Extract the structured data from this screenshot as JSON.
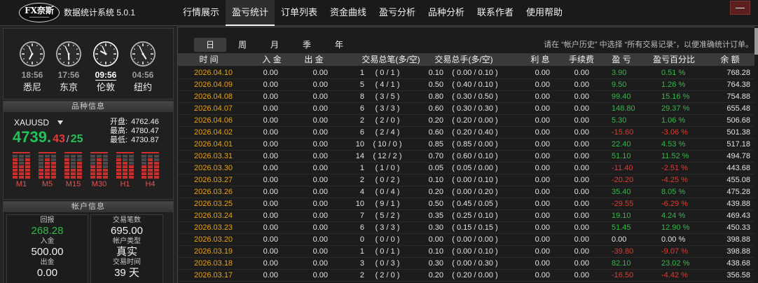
{
  "app": {
    "logo_text": "FX奈斯",
    "title": "数据统计系统 5.0.1",
    "minimize_label": "—"
  },
  "nav": {
    "active_index": 1,
    "tabs": [
      {
        "label": "行情展示"
      },
      {
        "label": "盈亏统计"
      },
      {
        "label": "订单列表"
      },
      {
        "label": "资金曲线"
      },
      {
        "label": "盈亏分析"
      },
      {
        "label": "品种分析"
      },
      {
        "label": "联系作者"
      },
      {
        "label": "使用帮助"
      }
    ]
  },
  "clocks": [
    {
      "time": "18:56",
      "city": "悉尼",
      "active": false
    },
    {
      "time": "17:56",
      "city": "东京",
      "active": false
    },
    {
      "time": "09:56",
      "city": "伦敦",
      "active": true
    },
    {
      "time": "04:56",
      "city": "纽约",
      "active": false
    }
  ],
  "symbol": {
    "section_title": "品种信息",
    "name": "XAUUSD",
    "dropdown_icon": "caret-down-icon",
    "price_main": "4739.",
    "price_pips": "43",
    "price_separator": "/",
    "price_pips_2": "25",
    "open_label": "开盘:",
    "open": "4762.46",
    "high_label": "最高:",
    "high": "4780.47",
    "low_label": "最低:",
    "low": "4730.87",
    "timeframes": [
      {
        "label": "M1",
        "levels": [
          0.86,
          0.57,
          0.86
        ]
      },
      {
        "label": "M5",
        "levels": [
          0.43,
          0.86,
          0.71
        ]
      },
      {
        "label": "M15",
        "levels": [
          0.86,
          0.43,
          0.71
        ]
      },
      {
        "label": "M30",
        "levels": [
          0.57,
          0.86,
          0.43
        ]
      },
      {
        "label": "H1",
        "levels": [
          0.86,
          0.71,
          0.57
        ]
      },
      {
        "label": "H4",
        "levels": [
          0.57,
          0.86,
          0.71
        ]
      }
    ]
  },
  "account": {
    "section_title": "帐户信息",
    "left": [
      {
        "label": "回报",
        "value": "268.28"
      },
      {
        "label": "入金",
        "value": "500.00"
      },
      {
        "label": "出金",
        "value": "0.00"
      }
    ],
    "right": [
      {
        "label": "交易笔数",
        "value": "695.00"
      },
      {
        "label": "帐户类型",
        "value": "真实"
      },
      {
        "label": "交易时间",
        "value": "39 天"
      }
    ]
  },
  "stats": {
    "active_period": 0,
    "periods": [
      "日",
      "周",
      "月",
      "季",
      "年"
    ],
    "hint": "请在 “帐户历史” 中选择 “所有交易记录”，以便准确统计订单。",
    "columns": [
      "时 间",
      "入 金",
      "出 金",
      "交易总笔(多/空)",
      "交易总手(多/空)",
      "利 息",
      "手续费",
      "盈 亏",
      "盈亏百分比",
      "余 额"
    ],
    "rows": [
      {
        "date": "2026.04.10",
        "deposit": "0.00",
        "withdraw": "0.00",
        "trades": "1",
        "trades_split": "( 0 / 1 )",
        "lots": "0.10",
        "lots_split": "( 0.00 / 0.10 )",
        "interest": "0.00",
        "fee": "0.00",
        "profit": "3.90",
        "pct": "0.51 %",
        "balance": "768.28"
      },
      {
        "date": "2026.04.09",
        "deposit": "0.00",
        "withdraw": "0.00",
        "trades": "5",
        "trades_split": "( 4 / 1 )",
        "lots": "0.50",
        "lots_split": "( 0.40 / 0.10 )",
        "interest": "0.00",
        "fee": "0.00",
        "profit": "9.50",
        "pct": "1.26 %",
        "balance": "764.38"
      },
      {
        "date": "2026.04.08",
        "deposit": "0.00",
        "withdraw": "0.00",
        "trades": "8",
        "trades_split": "( 3 / 5 )",
        "lots": "0.80",
        "lots_split": "( 0.30 / 0.50 )",
        "interest": "0.00",
        "fee": "0.00",
        "profit": "99.40",
        "pct": "15.16 %",
        "balance": "754.88"
      },
      {
        "date": "2026.04.07",
        "deposit": "0.00",
        "withdraw": "0.00",
        "trades": "6",
        "trades_split": "( 3 / 3 )",
        "lots": "0.60",
        "lots_split": "( 0.30 / 0.30 )",
        "interest": "0.00",
        "fee": "0.00",
        "profit": "148.80",
        "pct": "29.37 %",
        "balance": "655.48"
      },
      {
        "date": "2026.04.06",
        "deposit": "0.00",
        "withdraw": "0.00",
        "trades": "2",
        "trades_split": "( 2 / 0 )",
        "lots": "0.20",
        "lots_split": "( 0.20 / 0.00 )",
        "interest": "0.00",
        "fee": "0.00",
        "profit": "5.30",
        "pct": "1.06 %",
        "balance": "506.68"
      },
      {
        "date": "2026.04.02",
        "deposit": "0.00",
        "withdraw": "0.00",
        "trades": "6",
        "trades_split": "( 2 / 4 )",
        "lots": "0.60",
        "lots_split": "( 0.20 / 0.40 )",
        "interest": "0.00",
        "fee": "0.00",
        "profit": "-15.60",
        "pct": "-3.06 %",
        "balance": "501.38"
      },
      {
        "date": "2026.04.01",
        "deposit": "0.00",
        "withdraw": "0.00",
        "trades": "10",
        "trades_split": "( 10 / 0 )",
        "lots": "0.85",
        "lots_split": "( 0.85 / 0.00 )",
        "interest": "0.00",
        "fee": "0.00",
        "profit": "22.40",
        "pct": "4.53 %",
        "balance": "517.18"
      },
      {
        "date": "2026.03.31",
        "deposit": "0.00",
        "withdraw": "0.00",
        "trades": "14",
        "trades_split": "( 12 / 2 )",
        "lots": "0.70",
        "lots_split": "( 0.60 / 0.10 )",
        "interest": "0.00",
        "fee": "0.00",
        "profit": "51.10",
        "pct": "11.52 %",
        "balance": "494.78"
      },
      {
        "date": "2026.03.30",
        "deposit": "0.00",
        "withdraw": "0.00",
        "trades": "1",
        "trades_split": "( 1 / 0 )",
        "lots": "0.05",
        "lots_split": "( 0.05 / 0.00 )",
        "interest": "0.00",
        "fee": "0.00",
        "profit": "-11.40",
        "pct": "-2.51 %",
        "balance": "443.68"
      },
      {
        "date": "2026.03.27",
        "deposit": "0.00",
        "withdraw": "0.00",
        "trades": "2",
        "trades_split": "( 0 / 2 )",
        "lots": "0.10",
        "lots_split": "( 0.00 / 0.10 )",
        "interest": "0.00",
        "fee": "0.00",
        "profit": "-20.20",
        "pct": "-4.25 %",
        "balance": "455.08"
      },
      {
        "date": "2026.03.26",
        "deposit": "0.00",
        "withdraw": "0.00",
        "trades": "4",
        "trades_split": "( 0 / 4 )",
        "lots": "0.20",
        "lots_split": "( 0.00 / 0.20 )",
        "interest": "0.00",
        "fee": "0.00",
        "profit": "35.40",
        "pct": "8.05 %",
        "balance": "475.28"
      },
      {
        "date": "2026.03.25",
        "deposit": "0.00",
        "withdraw": "0.00",
        "trades": "10",
        "trades_split": "( 9 / 1 )",
        "lots": "0.50",
        "lots_split": "( 0.45 / 0.05 )",
        "interest": "0.00",
        "fee": "0.00",
        "profit": "-29.55",
        "pct": "-6.29 %",
        "balance": "439.88"
      },
      {
        "date": "2026.03.24",
        "deposit": "0.00",
        "withdraw": "0.00",
        "trades": "7",
        "trades_split": "( 5 / 2 )",
        "lots": "0.35",
        "lots_split": "( 0.25 / 0.10 )",
        "interest": "0.00",
        "fee": "0.00",
        "profit": "19.10",
        "pct": "4.24 %",
        "balance": "469.43"
      },
      {
        "date": "2026.03.23",
        "deposit": "0.00",
        "withdraw": "0.00",
        "trades": "6",
        "trades_split": "( 3 / 3 )",
        "lots": "0.30",
        "lots_split": "( 0.15 / 0.15 )",
        "interest": "0.00",
        "fee": "0.00",
        "profit": "51.45",
        "pct": "12.90 %",
        "balance": "450.33"
      },
      {
        "date": "2026.03.20",
        "deposit": "0.00",
        "withdraw": "0.00",
        "trades": "0",
        "trades_split": "( 0 / 0 )",
        "lots": "0.00",
        "lots_split": "( 0.00 / 0.00 )",
        "interest": "0.00",
        "fee": "0.00",
        "profit": "0.00",
        "pct": "0.00 %",
        "balance": "398.88"
      },
      {
        "date": "2026.03.19",
        "deposit": "0.00",
        "withdraw": "0.00",
        "trades": "1",
        "trades_split": "( 0 / 1 )",
        "lots": "0.10",
        "lots_split": "( 0.00 / 0.10 )",
        "interest": "0.00",
        "fee": "0.00",
        "profit": "-39.80",
        "pct": "-9.07 %",
        "balance": "398.88"
      },
      {
        "date": "2026.03.18",
        "deposit": "0.00",
        "withdraw": "0.00",
        "trades": "3",
        "trades_split": "( 0 / 3 )",
        "lots": "0.30",
        "lots_split": "( 0.00 / 0.30 )",
        "interest": "0.00",
        "fee": "0.00",
        "profit": "82.10",
        "pct": "23.02 %",
        "balance": "438.68"
      },
      {
        "date": "2026.03.17",
        "deposit": "0.00",
        "withdraw": "0.00",
        "trades": "2",
        "trades_split": "( 2 / 0 )",
        "lots": "0.20",
        "lots_split": "( 0.20 / 0.00 )",
        "interest": "0.00",
        "fee": "0.00",
        "profit": "-16.50",
        "pct": "-4.42 %",
        "balance": "356.58"
      }
    ]
  },
  "colors": {
    "positive": "#35b84a",
    "negative": "#e5392f",
    "neutral": "#e4e4e4",
    "date": "#e8a21a",
    "account_return": "#35b84a"
  }
}
